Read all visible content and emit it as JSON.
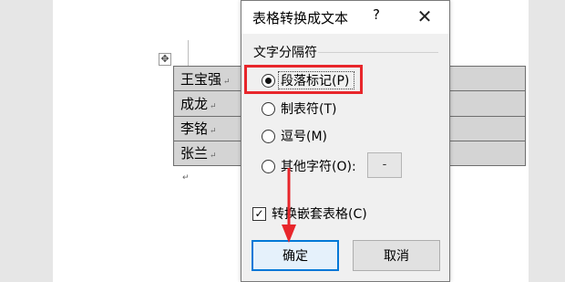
{
  "document": {
    "move_handle_glyph": "✥",
    "paragraph_mark": "↵",
    "rows": [
      {
        "name": "王宝强"
      },
      {
        "name": "成龙"
      },
      {
        "name": "李铭"
      },
      {
        "name": "张兰"
      }
    ]
  },
  "dialog": {
    "title": "表格转换成文本",
    "help": "?",
    "close": "✕",
    "group_label": "文字分隔符",
    "options": [
      {
        "label": "段落标记(P)",
        "selected": true
      },
      {
        "label": "制表符(T)",
        "selected": false
      },
      {
        "label": "逗号(M)",
        "selected": false
      },
      {
        "label": "其他字符(O):",
        "selected": false
      }
    ],
    "other_char_value": "-",
    "nested_tables": {
      "label": "转换嵌套表格(C)",
      "checked": true,
      "check_glyph": "✓"
    },
    "ok_label": "确定",
    "cancel_label": "取消"
  },
  "colors": {
    "highlight": "#e8262b",
    "cell_fill": "#d4d4d4",
    "focus_border": "#0078d7"
  }
}
